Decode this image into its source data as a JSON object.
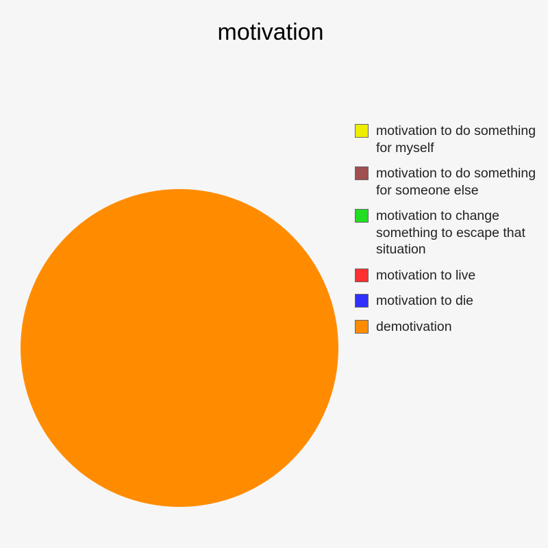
{
  "chart_data": {
    "type": "pie",
    "title": "motivation",
    "legend_position": "right",
    "series": [
      {
        "name": "motivation to do something for myself",
        "value": 0,
        "color": "#eeee00"
      },
      {
        "name": "motivation to do something for someone else",
        "value": 0,
        "color": "#a05050"
      },
      {
        "name": "motivation to change something to escape that situation",
        "value": 0,
        "color": "#22dd22"
      },
      {
        "name": "motivation to live",
        "value": 0,
        "color": "#ff3030"
      },
      {
        "name": "motivation to die",
        "value": 0,
        "color": "#3030ff"
      },
      {
        "name": "demotivation",
        "value": 100,
        "color": "#ff8c00"
      }
    ]
  }
}
